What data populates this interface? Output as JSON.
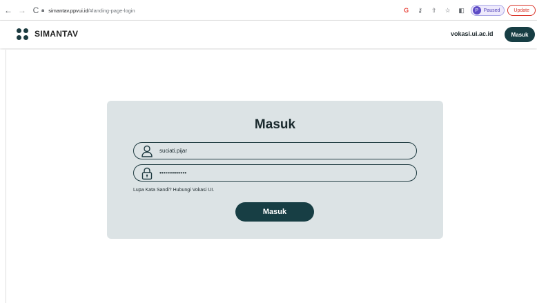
{
  "browser": {
    "url_host": "simantav.ppvui.id",
    "url_path": "/#landing-page-login",
    "profile_initial": "P",
    "profile_status": "Paused",
    "update_label": "Update"
  },
  "header": {
    "brand": "SIMANTAV",
    "external_link": "vokasi.ui.ac.id",
    "login_button": "Masuk"
  },
  "login_card": {
    "title": "Masuk",
    "username_value": "suciati.pijar",
    "password_value": "••••••••••••••",
    "hint": "Lupa Kata Sandi? Hubungi Vokasi UI.",
    "submit_label": "Masuk"
  },
  "colors": {
    "brand_dark": "#173e44",
    "card_bg": "#dce3e5"
  }
}
